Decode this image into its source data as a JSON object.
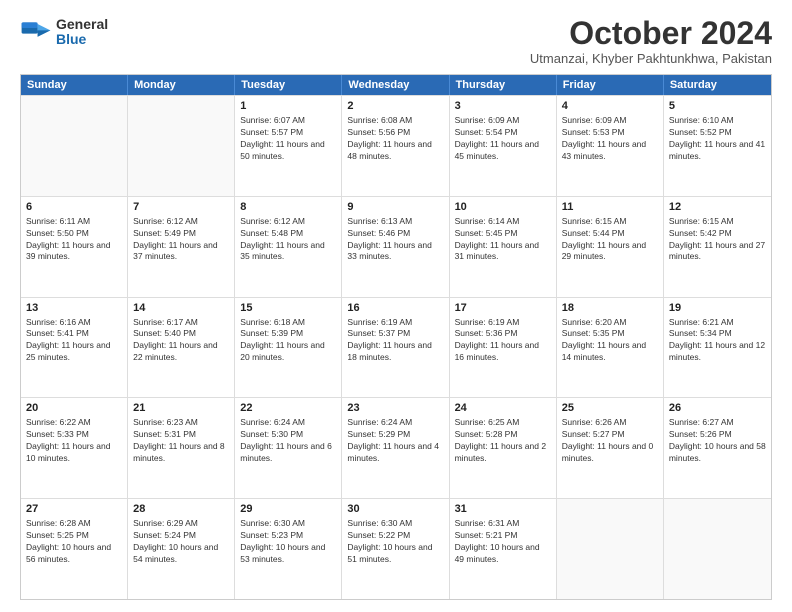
{
  "logo": {
    "general": "General",
    "blue": "Blue"
  },
  "title": "October 2024",
  "location": "Utmanzai, Khyber Pakhtunkhwa, Pakistan",
  "days": [
    "Sunday",
    "Monday",
    "Tuesday",
    "Wednesday",
    "Thursday",
    "Friday",
    "Saturday"
  ],
  "weeks": [
    [
      {
        "day": "",
        "sunrise": "",
        "sunset": "",
        "daylight": ""
      },
      {
        "day": "",
        "sunrise": "",
        "sunset": "",
        "daylight": ""
      },
      {
        "day": "1",
        "sunrise": "Sunrise: 6:07 AM",
        "sunset": "Sunset: 5:57 PM",
        "daylight": "Daylight: 11 hours and 50 minutes."
      },
      {
        "day": "2",
        "sunrise": "Sunrise: 6:08 AM",
        "sunset": "Sunset: 5:56 PM",
        "daylight": "Daylight: 11 hours and 48 minutes."
      },
      {
        "day": "3",
        "sunrise": "Sunrise: 6:09 AM",
        "sunset": "Sunset: 5:54 PM",
        "daylight": "Daylight: 11 hours and 45 minutes."
      },
      {
        "day": "4",
        "sunrise": "Sunrise: 6:09 AM",
        "sunset": "Sunset: 5:53 PM",
        "daylight": "Daylight: 11 hours and 43 minutes."
      },
      {
        "day": "5",
        "sunrise": "Sunrise: 6:10 AM",
        "sunset": "Sunset: 5:52 PM",
        "daylight": "Daylight: 11 hours and 41 minutes."
      }
    ],
    [
      {
        "day": "6",
        "sunrise": "Sunrise: 6:11 AM",
        "sunset": "Sunset: 5:50 PM",
        "daylight": "Daylight: 11 hours and 39 minutes."
      },
      {
        "day": "7",
        "sunrise": "Sunrise: 6:12 AM",
        "sunset": "Sunset: 5:49 PM",
        "daylight": "Daylight: 11 hours and 37 minutes."
      },
      {
        "day": "8",
        "sunrise": "Sunrise: 6:12 AM",
        "sunset": "Sunset: 5:48 PM",
        "daylight": "Daylight: 11 hours and 35 minutes."
      },
      {
        "day": "9",
        "sunrise": "Sunrise: 6:13 AM",
        "sunset": "Sunset: 5:46 PM",
        "daylight": "Daylight: 11 hours and 33 minutes."
      },
      {
        "day": "10",
        "sunrise": "Sunrise: 6:14 AM",
        "sunset": "Sunset: 5:45 PM",
        "daylight": "Daylight: 11 hours and 31 minutes."
      },
      {
        "day": "11",
        "sunrise": "Sunrise: 6:15 AM",
        "sunset": "Sunset: 5:44 PM",
        "daylight": "Daylight: 11 hours and 29 minutes."
      },
      {
        "day": "12",
        "sunrise": "Sunrise: 6:15 AM",
        "sunset": "Sunset: 5:42 PM",
        "daylight": "Daylight: 11 hours and 27 minutes."
      }
    ],
    [
      {
        "day": "13",
        "sunrise": "Sunrise: 6:16 AM",
        "sunset": "Sunset: 5:41 PM",
        "daylight": "Daylight: 11 hours and 25 minutes."
      },
      {
        "day": "14",
        "sunrise": "Sunrise: 6:17 AM",
        "sunset": "Sunset: 5:40 PM",
        "daylight": "Daylight: 11 hours and 22 minutes."
      },
      {
        "day": "15",
        "sunrise": "Sunrise: 6:18 AM",
        "sunset": "Sunset: 5:39 PM",
        "daylight": "Daylight: 11 hours and 20 minutes."
      },
      {
        "day": "16",
        "sunrise": "Sunrise: 6:19 AM",
        "sunset": "Sunset: 5:37 PM",
        "daylight": "Daylight: 11 hours and 18 minutes."
      },
      {
        "day": "17",
        "sunrise": "Sunrise: 6:19 AM",
        "sunset": "Sunset: 5:36 PM",
        "daylight": "Daylight: 11 hours and 16 minutes."
      },
      {
        "day": "18",
        "sunrise": "Sunrise: 6:20 AM",
        "sunset": "Sunset: 5:35 PM",
        "daylight": "Daylight: 11 hours and 14 minutes."
      },
      {
        "day": "19",
        "sunrise": "Sunrise: 6:21 AM",
        "sunset": "Sunset: 5:34 PM",
        "daylight": "Daylight: 11 hours and 12 minutes."
      }
    ],
    [
      {
        "day": "20",
        "sunrise": "Sunrise: 6:22 AM",
        "sunset": "Sunset: 5:33 PM",
        "daylight": "Daylight: 11 hours and 10 minutes."
      },
      {
        "day": "21",
        "sunrise": "Sunrise: 6:23 AM",
        "sunset": "Sunset: 5:31 PM",
        "daylight": "Daylight: 11 hours and 8 minutes."
      },
      {
        "day": "22",
        "sunrise": "Sunrise: 6:24 AM",
        "sunset": "Sunset: 5:30 PM",
        "daylight": "Daylight: 11 hours and 6 minutes."
      },
      {
        "day": "23",
        "sunrise": "Sunrise: 6:24 AM",
        "sunset": "Sunset: 5:29 PM",
        "daylight": "Daylight: 11 hours and 4 minutes."
      },
      {
        "day": "24",
        "sunrise": "Sunrise: 6:25 AM",
        "sunset": "Sunset: 5:28 PM",
        "daylight": "Daylight: 11 hours and 2 minutes."
      },
      {
        "day": "25",
        "sunrise": "Sunrise: 6:26 AM",
        "sunset": "Sunset: 5:27 PM",
        "daylight": "Daylight: 11 hours and 0 minutes."
      },
      {
        "day": "26",
        "sunrise": "Sunrise: 6:27 AM",
        "sunset": "Sunset: 5:26 PM",
        "daylight": "Daylight: 10 hours and 58 minutes."
      }
    ],
    [
      {
        "day": "27",
        "sunrise": "Sunrise: 6:28 AM",
        "sunset": "Sunset: 5:25 PM",
        "daylight": "Daylight: 10 hours and 56 minutes."
      },
      {
        "day": "28",
        "sunrise": "Sunrise: 6:29 AM",
        "sunset": "Sunset: 5:24 PM",
        "daylight": "Daylight: 10 hours and 54 minutes."
      },
      {
        "day": "29",
        "sunrise": "Sunrise: 6:30 AM",
        "sunset": "Sunset: 5:23 PM",
        "daylight": "Daylight: 10 hours and 53 minutes."
      },
      {
        "day": "30",
        "sunrise": "Sunrise: 6:30 AM",
        "sunset": "Sunset: 5:22 PM",
        "daylight": "Daylight: 10 hours and 51 minutes."
      },
      {
        "day": "31",
        "sunrise": "Sunrise: 6:31 AM",
        "sunset": "Sunset: 5:21 PM",
        "daylight": "Daylight: 10 hours and 49 minutes."
      },
      {
        "day": "",
        "sunrise": "",
        "sunset": "",
        "daylight": ""
      },
      {
        "day": "",
        "sunrise": "",
        "sunset": "",
        "daylight": ""
      }
    ]
  ]
}
